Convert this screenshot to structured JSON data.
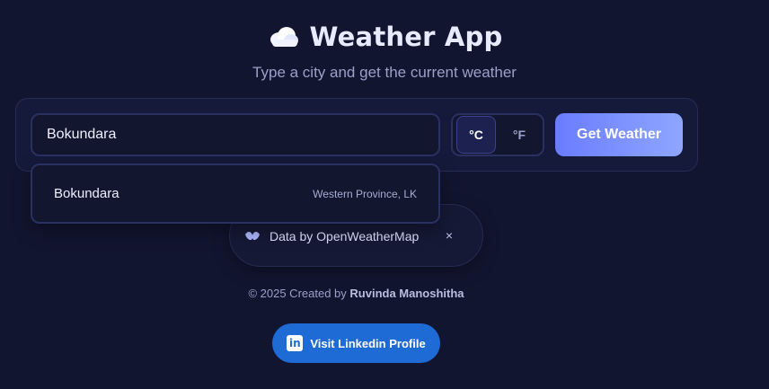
{
  "header": {
    "title": "Weather App",
    "subtitle": "Type a city and get the current weather",
    "icon": "cloud-icon"
  },
  "search": {
    "value": "Bokundara",
    "placeholder": "",
    "units": {
      "celsius_label": "°C",
      "fahrenheit_label": "°F",
      "selected": "°C"
    },
    "button_label": "Get Weather"
  },
  "suggestions": [
    {
      "name": "Bokundara",
      "region": "Western Province, LK"
    }
  ],
  "credit": {
    "text": "Data by OpenWeatherMap",
    "close_symbol": "×"
  },
  "footer": {
    "copyright_prefix": "© 2025 Created by",
    "author": "Ruvinda Manoshitha",
    "linkedin_icon_text": "in",
    "linkedin_label": "Visit Linkedin Profile"
  },
  "colors": {
    "background": "#121530",
    "accent_gradient_start": "#6a7cff",
    "accent_gradient_end": "#8fa6ff",
    "linkedin_blue": "#1f6bd6"
  }
}
